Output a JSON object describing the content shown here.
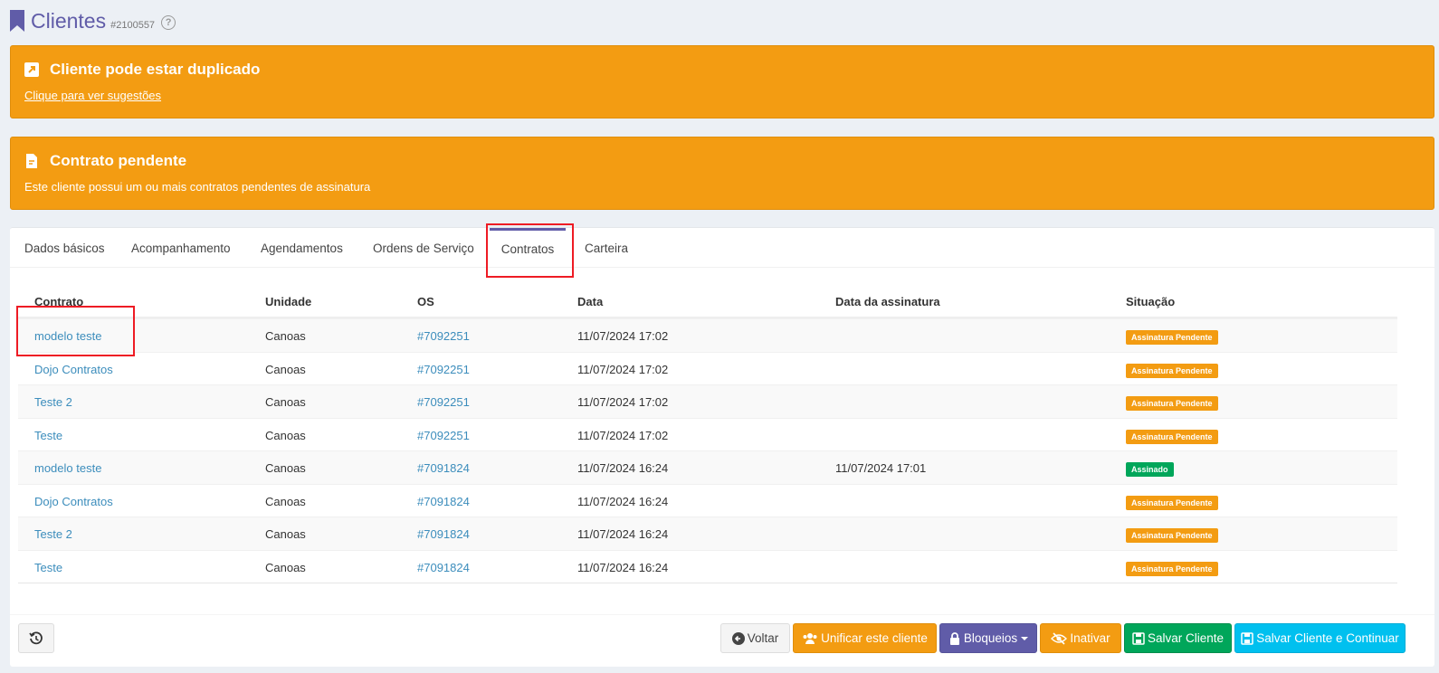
{
  "header": {
    "title": "Clientes",
    "client_id": "#2100557",
    "help": "?"
  },
  "alerts": {
    "duplicate": {
      "title": "Cliente pode estar duplicado",
      "link": "Clique para ver sugestões"
    },
    "contract": {
      "title": "Contrato pendente",
      "text": "Este cliente possui um ou mais contratos pendentes de assinatura"
    }
  },
  "tabs": [
    "Dados básicos",
    "Acompanhamento",
    "Agendamentos",
    "Ordens de Serviço",
    "Contratos",
    "Carteira"
  ],
  "active_tab": "Contratos",
  "table": {
    "headers": [
      "Contrato",
      "Unidade",
      "OS",
      "Data",
      "Data da assinatura",
      "Situação"
    ],
    "rows": [
      {
        "contrato": "modelo teste",
        "unidade": "Canoas",
        "os": "#7092251",
        "data": "11/07/2024 17:02",
        "assinatura": "",
        "situacao": "Assinatura Pendente"
      },
      {
        "contrato": "Dojo Contratos",
        "unidade": "Canoas",
        "os": "#7092251",
        "data": "11/07/2024 17:02",
        "assinatura": "",
        "situacao": "Assinatura Pendente"
      },
      {
        "contrato": "Teste 2",
        "unidade": "Canoas",
        "os": "#7092251",
        "data": "11/07/2024 17:02",
        "assinatura": "",
        "situacao": "Assinatura Pendente"
      },
      {
        "contrato": "Teste",
        "unidade": "Canoas",
        "os": "#7092251",
        "data": "11/07/2024 17:02",
        "assinatura": "",
        "situacao": "Assinatura Pendente"
      },
      {
        "contrato": "modelo teste",
        "unidade": "Canoas",
        "os": "#7091824",
        "data": "11/07/2024 16:24",
        "assinatura": "11/07/2024 17:01",
        "situacao": "Assinado"
      },
      {
        "contrato": "Dojo Contratos",
        "unidade": "Canoas",
        "os": "#7091824",
        "data": "11/07/2024 16:24",
        "assinatura": "",
        "situacao": "Assinatura Pendente"
      },
      {
        "contrato": "Teste 2",
        "unidade": "Canoas",
        "os": "#7091824",
        "data": "11/07/2024 16:24",
        "assinatura": "",
        "situacao": "Assinatura Pendente"
      },
      {
        "contrato": "Teste",
        "unidade": "Canoas",
        "os": "#7091824",
        "data": "11/07/2024 16:24",
        "assinatura": "",
        "situacao": "Assinatura Pendente"
      }
    ]
  },
  "footer": {
    "voltar": "Voltar",
    "unificar": "Unificar este cliente",
    "bloqueios": "Bloqueios",
    "inativar": "Inativar",
    "salvar": "Salvar Cliente",
    "salvar_continuar": "Salvar Cliente e Continuar"
  },
  "colors": {
    "primary": "#605ca8",
    "warning": "#f39c12",
    "success": "#00a65a",
    "info": "#00c0ef",
    "link": "#3c8dbc",
    "highlight": "#ee1b24"
  }
}
